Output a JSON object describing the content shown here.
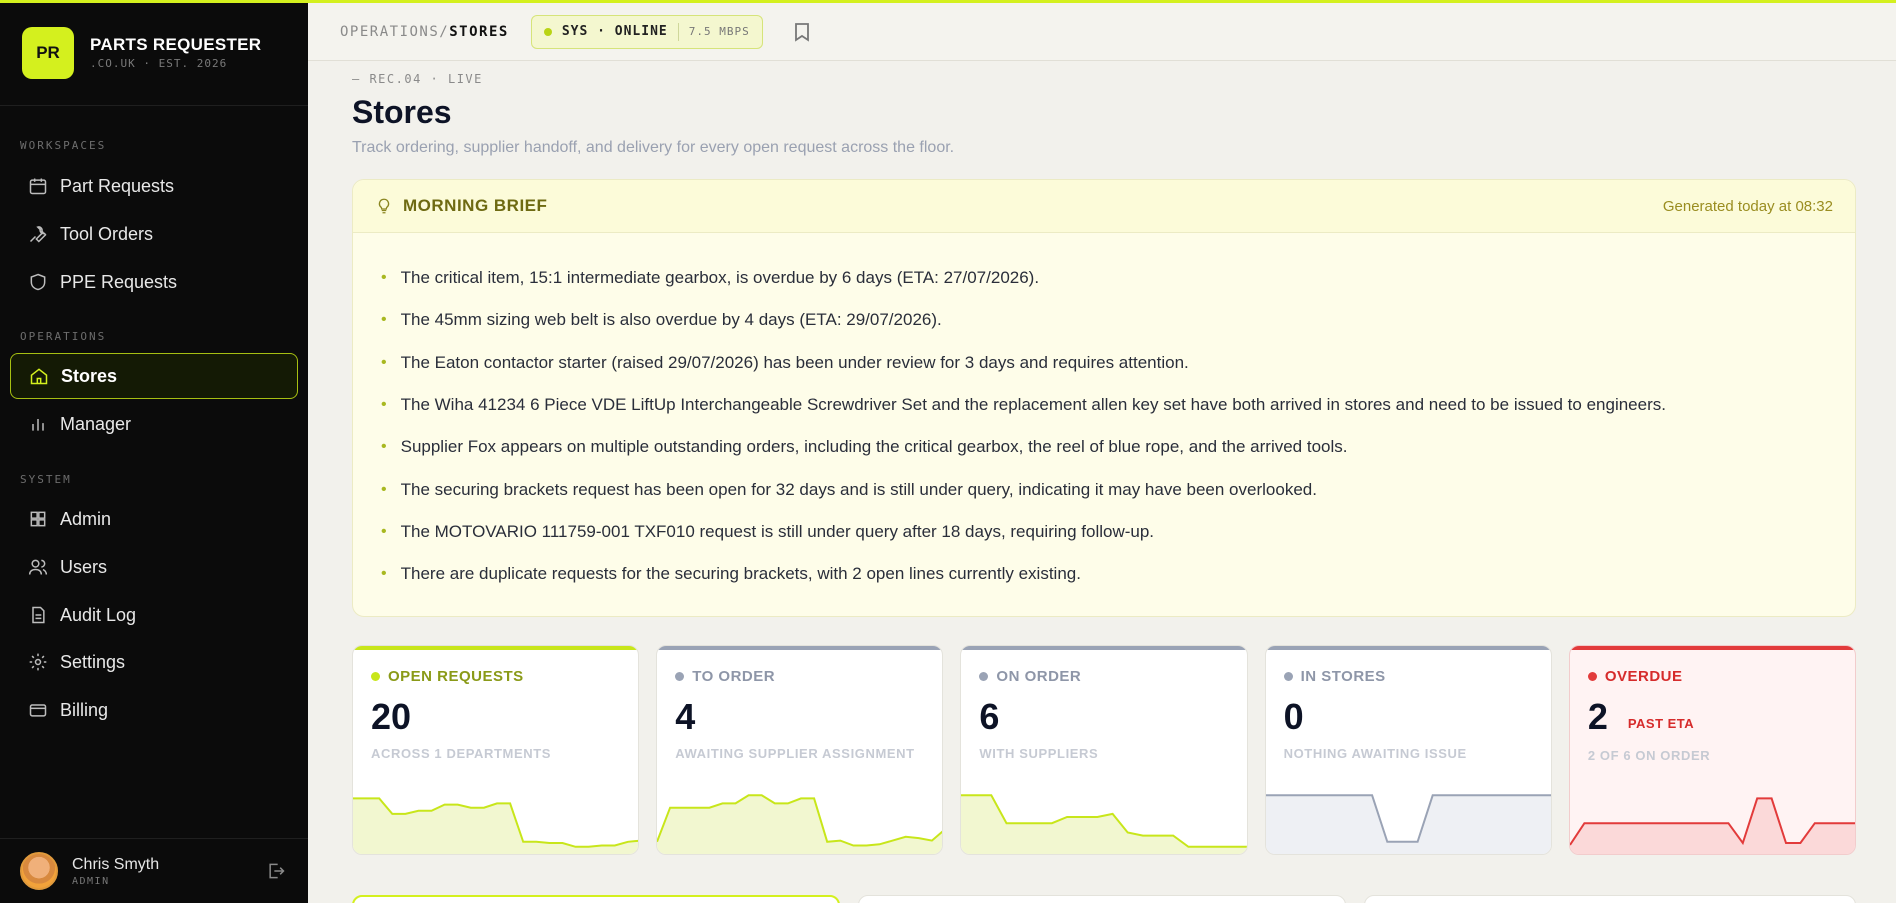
{
  "app": {
    "logo_text": "PR",
    "name": "PARTS REQUESTER",
    "sub": ".CO.UK · EST. 2026"
  },
  "sidebar": {
    "sections": [
      {
        "label": "WORKSPACES"
      },
      {
        "label": "OPERATIONS"
      },
      {
        "label": "SYSTEM"
      }
    ],
    "items": [
      {
        "label": "Part Requests",
        "icon": "calendar-icon"
      },
      {
        "label": "Tool Orders",
        "icon": "wrench-icon"
      },
      {
        "label": "PPE Requests",
        "icon": "shield-icon"
      },
      {
        "label": "Stores",
        "icon": "home-icon",
        "active": true
      },
      {
        "label": "Manager",
        "icon": "bar-chart-icon"
      },
      {
        "label": "Admin",
        "icon": "grid-icon"
      },
      {
        "label": "Users",
        "icon": "users-icon"
      },
      {
        "label": "Audit Log",
        "icon": "document-icon"
      },
      {
        "label": "Settings",
        "icon": "gear-icon"
      },
      {
        "label": "Billing",
        "icon": "credit-card-icon"
      }
    ],
    "user": {
      "name": "Chris Smyth",
      "role": "ADMIN"
    }
  },
  "header": {
    "crumb_parent": "OPERATIONS",
    "crumb_sep": "/",
    "crumb_current": "STORES",
    "status": "SYS · ONLINE",
    "speed": "7.5 MBPS"
  },
  "page": {
    "eyebrow": "— REC.04 · LIVE",
    "title": "Stores",
    "subtitle": "Track ordering, supplier handoff, and delivery for every open request across the floor."
  },
  "brief": {
    "title": "MORNING BRIEF",
    "generated": "Generated today at 08:32",
    "items": [
      "The critical item, 15:1 intermediate gearbox, is overdue by 6 days (ETA: 27/07/2026).",
      "The 45mm sizing web belt is also overdue by 4 days (ETA: 29/07/2026).",
      "The Eaton contactor starter (raised 29/07/2026) has been under review for 3 days and requires attention.",
      "The Wiha 41234 6 Piece VDE LiftUp Interchangeable Screwdriver Set and the replacement allen key set have both arrived in stores and need to be issued to engineers.",
      "Supplier Fox appears on multiple outstanding orders, including the critical gearbox, the reel of blue rope, and the arrived tools.",
      "The securing brackets request has been open for 32 days and is still under query, indicating it may have been overlooked.",
      "The MOTOVARIO 111759-001 TXF010 request is still under query after 18 days, requiring follow-up.",
      "There are duplicate requests for the securing brackets, with 2 open lines currently existing."
    ]
  },
  "stats": [
    {
      "label": "OPEN REQUESTS",
      "value": "20",
      "badge": "",
      "sub": "ACROSS 1 DEPARTMENTS",
      "color": "#c8e61a",
      "label_color": "#8a9a18",
      "fill": "#f2f7d0",
      "stroke": "#c8e61a",
      "trend": [
        0.8,
        0.8,
        0.8,
        0.55,
        0.55,
        0.6,
        0.6,
        0.7,
        0.7,
        0.65,
        0.65,
        0.72,
        0.72,
        0.1,
        0.1,
        0.08,
        0.08,
        0.02,
        0.02,
        0.04,
        0.04,
        0.1,
        0.12
      ]
    },
    {
      "label": "TO ORDER",
      "value": "4",
      "badge": "",
      "sub": "AWAITING SUPPLIER ASSIGNMENT",
      "color": "#9aa3b5",
      "label_color": "#8e96a8",
      "fill": "#f2f7d0",
      "stroke": "#c8e61a",
      "trend": [
        0.1,
        0.65,
        0.65,
        0.65,
        0.65,
        0.72,
        0.72,
        0.85,
        0.85,
        0.72,
        0.72,
        0.8,
        0.8,
        0.1,
        0.12,
        0.04,
        0.04,
        0.06,
        0.12,
        0.18,
        0.16,
        0.12,
        0.3
      ]
    },
    {
      "label": "ON ORDER",
      "value": "6",
      "badge": "",
      "sub": "WITH SUPPLIERS",
      "color": "#9aa3b5",
      "label_color": "#8e96a8",
      "fill": "#f2f7d0",
      "stroke": "#c8e61a",
      "trend": [
        0.85,
        0.85,
        0.85,
        0.4,
        0.4,
        0.4,
        0.4,
        0.5,
        0.5,
        0.5,
        0.55,
        0.25,
        0.2,
        0.2,
        0.2,
        0.02,
        0.02,
        0.02,
        0.02,
        0.02
      ]
    },
    {
      "label": "IN STORES",
      "value": "0",
      "badge": "",
      "sub": "NOTHING AWAITING ISSUE",
      "color": "#9aa3b5",
      "label_color": "#8e96a8",
      "fill": "#eef0f4",
      "stroke": "#9aa3b5",
      "trend": [
        0.85,
        0.85,
        0.85,
        0.85,
        0.85,
        0.85,
        0.85,
        0.85,
        0.1,
        0.1,
        0.1,
        0.85,
        0.85,
        0.85,
        0.85,
        0.85,
        0.85,
        0.85,
        0.85,
        0.85
      ]
    },
    {
      "label": "OVERDUE",
      "value": "2",
      "badge": "PAST ETA",
      "sub": "2 OF 6 ON ORDER",
      "color": "#e23b3b",
      "label_color": "#d62b2b",
      "fill": "#fbd9d9",
      "stroke": "#e23b3b",
      "trend": [
        0.05,
        0.4,
        0.4,
        0.4,
        0.4,
        0.4,
        0.4,
        0.4,
        0.4,
        0.4,
        0.4,
        0.4,
        0.08,
        0.8,
        0.8,
        0.08,
        0.08,
        0.4,
        0.4,
        0.4,
        0.4
      ]
    }
  ]
}
